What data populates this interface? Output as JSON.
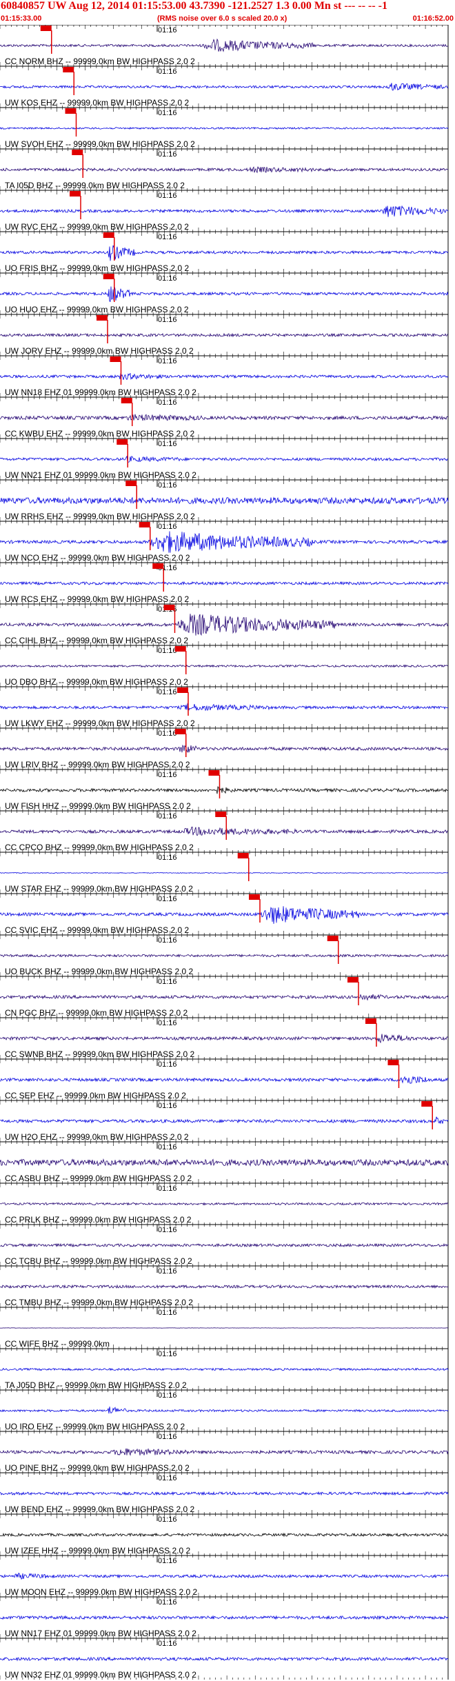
{
  "header": {
    "title": "60840857 UW Aug 12, 2014 01:15:53.00   43.7390  -121.2527  1.3 0.00 Mn st --- -- --  -1",
    "start_time": "01:15:33.00",
    "note": "(RMS noise over 6.0 s scaled 20.0 x)",
    "end_time": "01:16:52.00"
  },
  "colors": {
    "header_text": "#e00000",
    "pick": "#e00000",
    "trace_blue": "#0000e0",
    "trace_navy": "#200070",
    "trace_black": "#000000"
  },
  "chart_data": {
    "type": "line",
    "time_start": "01:15:33.00",
    "time_end": "01:16:52.00",
    "minute_mark": "01:16",
    "traces": [
      {
        "label": "CC NORM BHZ -- 99999.0km BW  HIGHPASS  2.0  2",
        "color": "#200070",
        "noise": 0.35,
        "pick": 0.115,
        "burst": [
          0.45,
          0.7,
          4.5
        ]
      },
      {
        "label": "UW KOS EHZ -- 99999.0km BW  HIGHPASS  2.0  2",
        "color": "#0000e0",
        "noise": 0.35,
        "pick": 0.165,
        "burst": [
          0.86,
          0.99,
          2.5
        ]
      },
      {
        "label": "UW SVOH EHZ -- 99999.0km BW  HIGHPASS  2.0  2",
        "color": "#0000e0",
        "noise": 0.25,
        "pick": 0.17,
        "burst": null
      },
      {
        "label": "TA I05D BHZ -- 99999.0km BW  HIGHPASS  2.0  2",
        "color": "#200070",
        "noise": 0.4,
        "pick": 0.185,
        "burst": [
          0.55,
          0.7,
          1.3
        ]
      },
      {
        "label": "UW RVC EHZ -- 99999.0km BW  HIGHPASS  2.0  2",
        "color": "#0000e0",
        "noise": 0.4,
        "pick": 0.18,
        "burst": [
          0.85,
          0.99,
          4.0
        ]
      },
      {
        "label": "UO FRIS BHZ -- 99999.0km BW  HIGHPASS  2.0  2",
        "color": "#0000e0",
        "noise": 0.4,
        "pick": 0.255,
        "burst": [
          0.24,
          0.3,
          5.5
        ]
      },
      {
        "label": "UO HUO EHZ -- 99999.0km BW  HIGHPASS  2.0  2",
        "color": "#0000e0",
        "noise": 0.4,
        "pick": 0.255,
        "burst": [
          0.24,
          0.29,
          6.0
        ]
      },
      {
        "label": "UW JORV EHZ -- 99999.0km BW  HIGHPASS  2.0  2",
        "color": "#200070",
        "noise": 0.4,
        "pick": 0.24,
        "burst": null
      },
      {
        "label": "UW NN18 EHZ 01 99999.0km BW  HIGHPASS  2.0  2",
        "color": "#0000e0",
        "noise": 0.4,
        "pick": 0.27,
        "burst": [
          0.26,
          0.36,
          1.6
        ]
      },
      {
        "label": "CC KWBU EHZ -- 99999.0km BW  HIGHPASS  2.0  2",
        "color": "#200070",
        "noise": 0.5,
        "pick": 0.295,
        "burst": [
          0.28,
          0.45,
          1.2
        ]
      },
      {
        "label": "UW NN21 EHZ 01 99999.0km BW  HIGHPASS  2.0  2",
        "color": "#0000e0",
        "noise": 0.4,
        "pick": 0.285,
        "burst": [
          0.27,
          0.4,
          1.3
        ]
      },
      {
        "label": "UW RRHS EHZ -- 99999.0km BW  HIGHPASS  2.0  2",
        "color": "#0000e0",
        "noise": 0.9,
        "pick": 0.305,
        "burst": null
      },
      {
        "label": "UW NCO EHZ -- 99999.0km BW  HIGHPASS  2.0  2",
        "color": "#0000e0",
        "noise": 0.45,
        "pick": 0.335,
        "burst": [
          0.33,
          0.7,
          6.5
        ]
      },
      {
        "label": "UW RCS EHZ -- 99999.0km BW  HIGHPASS  2.0  2",
        "color": "#0000e0",
        "noise": 0.4,
        "pick": 0.365,
        "burst": null
      },
      {
        "label": "CC CIHL BHZ -- 99999.0km BW  HIGHPASS  2.0  2",
        "color": "#200070",
        "noise": 0.45,
        "pick": 0.39,
        "burst": [
          0.39,
          0.75,
          6.5
        ]
      },
      {
        "label": "UO DBO BHZ -- 99999.0km BW  HIGHPASS  2.0  2",
        "color": "#200070",
        "noise": 0.3,
        "pick": 0.415,
        "burst": null
      },
      {
        "label": "UW LKWY EHZ -- 99999.0km BW  HIGHPASS  2.0  2",
        "color": "#0000e0",
        "noise": 0.4,
        "pick": 0.42,
        "burst": [
          0.4,
          0.6,
          1.8
        ]
      },
      {
        "label": "UW LRIV BHZ -- 99999.0km BW  HIGHPASS  2.0  2",
        "color": "#200070",
        "noise": 0.45,
        "pick": 0.415,
        "burst": [
          0.4,
          0.44,
          3.0
        ]
      },
      {
        "label": "UW FISH HHZ -- 99999.0km BW  HIGHPASS  2.0  2",
        "color": "#000000",
        "noise": 0.45,
        "pick": 0.49,
        "burst": [
          0.48,
          0.52,
          1.8
        ]
      },
      {
        "label": "CC CPCO BHZ -- 99999.0km BW  HIGHPASS  2.0  2",
        "color": "#200070",
        "noise": 0.45,
        "pick": 0.505,
        "burst": [
          0.4,
          0.66,
          2.0
        ]
      },
      {
        "label": "UW STAR EHZ -- 99999.0km BW  HIGHPASS  2.0  2",
        "color": "#0000e0",
        "noise": 0.1,
        "pick": 0.555,
        "burst": null
      },
      {
        "label": "CC SVIC EHZ -- 99999.0km BW  HIGHPASS  2.0  2",
        "color": "#0000e0",
        "noise": 0.45,
        "pick": 0.58,
        "burst": [
          0.58,
          0.8,
          5.5
        ]
      },
      {
        "label": "UO BUCK BHZ -- 99999.0km BW  HIGHPASS  2.0  2",
        "color": "#200070",
        "noise": 0.35,
        "pick": 0.755,
        "burst": null
      },
      {
        "label": "CN PGC BHZ -- 99999.0km BW  HIGHPASS  2.0  2",
        "color": "#200070",
        "noise": 0.45,
        "pick": 0.8,
        "burst": [
          0.8,
          0.86,
          1.5
        ]
      },
      {
        "label": "CC SWNB BHZ -- 99999.0km BW  HIGHPASS  2.0  2",
        "color": "#200070",
        "noise": 0.45,
        "pick": 0.84,
        "burst": [
          0.84,
          0.92,
          2.5
        ]
      },
      {
        "label": "CC SEP EHZ -- 99999.0km BW  HIGHPASS  2.0  2",
        "color": "#0000e0",
        "noise": 0.45,
        "pick": 0.89,
        "burst": [
          0.89,
          0.96,
          3.0
        ]
      },
      {
        "label": "UW H2O EHZ -- 99999.0km BW  HIGHPASS  2.0  2",
        "color": "#0000e0",
        "noise": 0.45,
        "pick": 0.965,
        "burst": [
          0.97,
          0.99,
          2.2
        ]
      },
      {
        "label": "CC ASBU BHZ -- 99999.0km BW  HIGHPASS  2.0  2",
        "color": "#200070",
        "noise": 0.9,
        "pick": null,
        "burst": null
      },
      {
        "label": "CC PRLK BHZ -- 99999.0km BW  HIGHPASS  2.0  2",
        "color": "#200070",
        "noise": 0.3,
        "pick": null,
        "burst": null
      },
      {
        "label": "CC TCBU BHZ -- 99999.0km BW  HIGHPASS  2.0  2",
        "color": "#200070",
        "noise": 0.4,
        "pick": null,
        "burst": null
      },
      {
        "label": "CC TMBU BHZ -- 99999.0km BW  HIGHPASS  2.0  2",
        "color": "#200070",
        "noise": 0.4,
        "pick": null,
        "burst": null
      },
      {
        "label": "CC WIFE BHZ -- 99999.0km",
        "color": "#200070",
        "noise": 0.05,
        "pick": null,
        "burst": null
      },
      {
        "label": "TA J05D BHZ -- 99999.0km BW  HIGHPASS  2.0  2",
        "color": "#0000e0",
        "noise": 0.3,
        "pick": null,
        "burst": null
      },
      {
        "label": "UO IRO EHZ -- 99999.0km BW  HIGHPASS  2.0  2",
        "color": "#0000e0",
        "noise": 0.3,
        "pick": null,
        "burst": [
          0.24,
          0.28,
          4.0
        ]
      },
      {
        "label": "UO PINE BHZ -- 99999.0km BW  HIGHPASS  2.0  2",
        "color": "#200070",
        "noise": 0.45,
        "pick": null,
        "burst": [
          0.25,
          0.42,
          1.8
        ]
      },
      {
        "label": "UW BEND EHZ -- 99999.0km BW  HIGHPASS  2.0  2",
        "color": "#0000e0",
        "noise": 0.4,
        "pick": null,
        "burst": null
      },
      {
        "label": "UW IZEE HHZ -- 99999.0km BW  HIGHPASS  2.0  2",
        "color": "#000000",
        "noise": 0.4,
        "pick": null,
        "burst": null
      },
      {
        "label": "UW MOON EHZ -- 99999.0km BW  HIGHPASS  2.0  2",
        "color": "#0000e0",
        "noise": 0.4,
        "pick": null,
        "burst": [
          0.03,
          0.12,
          1.4
        ]
      },
      {
        "label": "UW NN17 EHZ 01 99999.0km BW  HIGHPASS  2.0  2",
        "color": "#0000e0",
        "noise": 0.45,
        "pick": null,
        "burst": null
      },
      {
        "label": "UW NN32 EHZ 01 99999.0km BW  HIGHPASS  2.0  2",
        "color": "#0000e0",
        "noise": 0.45,
        "pick": null,
        "burst": null
      }
    ]
  }
}
